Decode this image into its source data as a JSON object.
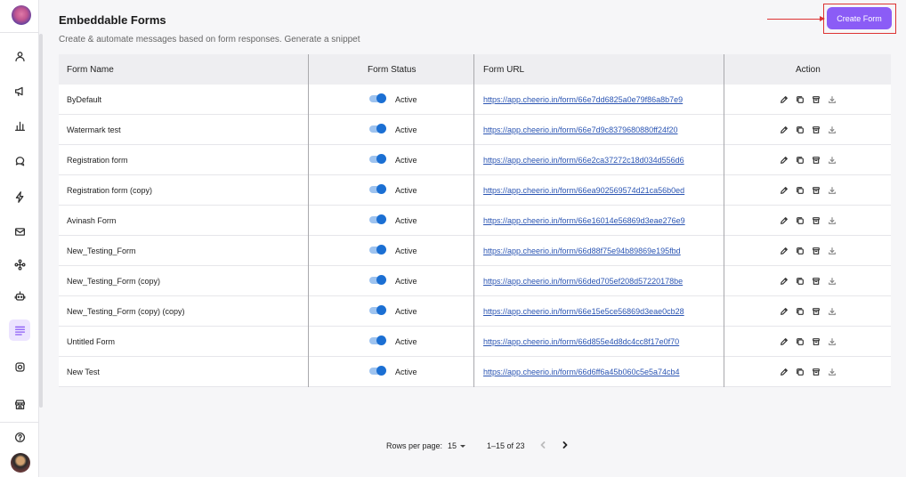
{
  "header": {
    "title": "Embeddable Forms",
    "subtitle": "Create & automate messages based on form responses. Generate a snippet",
    "create_button": "Create Form"
  },
  "sidebar": {
    "items": [
      {
        "icon": "user-icon"
      },
      {
        "icon": "megaphone-icon"
      },
      {
        "icon": "bar-chart-icon"
      },
      {
        "icon": "chat-icon"
      },
      {
        "icon": "lightning-icon"
      },
      {
        "icon": "mail-icon"
      },
      {
        "icon": "workflow-icon"
      },
      {
        "icon": "bot-icon"
      },
      {
        "icon": "forms-icon",
        "active": true
      },
      {
        "icon": "instagram-icon"
      },
      {
        "icon": "store-icon"
      }
    ],
    "help_icon": "help-icon",
    "accent": "#8b5cf6"
  },
  "table": {
    "columns": [
      "Form Name",
      "Form Status",
      "Form URL",
      "Action"
    ],
    "rows": [
      {
        "name": "ByDefault",
        "status": "Active",
        "url": "https://app.cheerio.in/form/66e7dd6825a0e79f86a8b7e9"
      },
      {
        "name": "Watermark test",
        "status": "Active",
        "url": "https://app.cheerio.in/form/66e7d9c8379680880ff24f20"
      },
      {
        "name": "Registration form",
        "status": "Active",
        "url": "https://app.cheerio.in/form/66e2ca37272c18d034d556d6"
      },
      {
        "name": "Registration form (copy)",
        "status": "Active",
        "url": "https://app.cheerio.in/form/66ea902569574d21ca56b0ed"
      },
      {
        "name": "Avinash Form",
        "status": "Active",
        "url": "https://app.cheerio.in/form/66e16014e56869d3eae276e9"
      },
      {
        "name": "New_Testing_Form",
        "status": "Active",
        "url": "https://app.cheerio.in/form/66d88f75e94b89869e195fbd"
      },
      {
        "name": "New_Testing_Form (copy)",
        "status": "Active",
        "url": "https://app.cheerio.in/form/66ded705ef208d57220178be"
      },
      {
        "name": "New_Testing_Form (copy) (copy)",
        "status": "Active",
        "url": "https://app.cheerio.in/form/66e15e5ce56869d3eae0cb28"
      },
      {
        "name": "Untitled Form",
        "status": "Active",
        "url": "https://app.cheerio.in/form/66d855e4d8dc4cc8f17e0f70"
      },
      {
        "name": "New Test",
        "status": "Active",
        "url": "https://app.cheerio.in/form/66d6ff6a45b060c5e5a74cb4"
      }
    ],
    "actions": [
      "edit-icon",
      "duplicate-icon",
      "delete-icon",
      "download-icon"
    ]
  },
  "pagination": {
    "rows_per_page_label": "Rows per page:",
    "rows_per_page": "15",
    "range": "1–15 of 23"
  },
  "colors": {
    "accent": "#8b5cf6",
    "toggle_on": "#1b6fd3",
    "link": "#2b55b3",
    "highlight_box": "#dd3333"
  }
}
